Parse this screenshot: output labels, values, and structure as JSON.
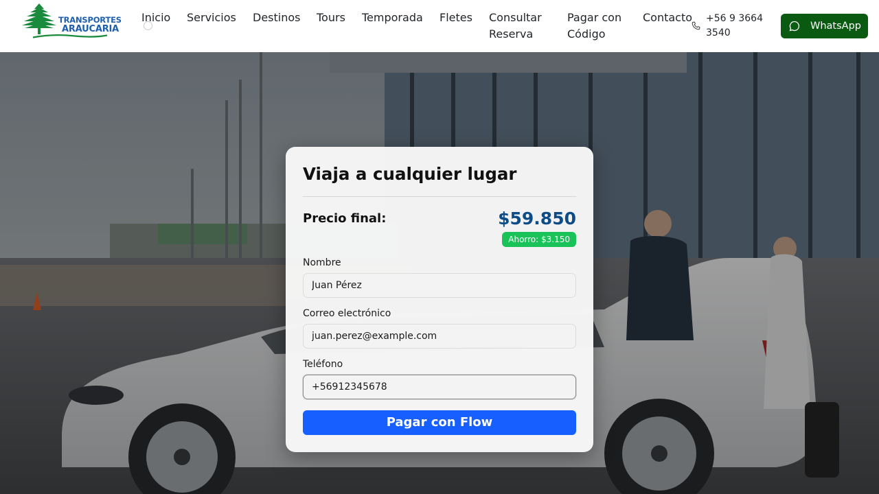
{
  "header": {
    "logo": {
      "line1": "TRANSPORTES",
      "line2": "ARAUCARIA",
      "icon": "araucaria-tree-icon"
    },
    "nav": [
      {
        "label": "Inicio"
      },
      {
        "label": "Servicios"
      },
      {
        "label": "Destinos"
      },
      {
        "label": "Tours"
      },
      {
        "label": "Temporada"
      },
      {
        "label": "Fletes"
      },
      {
        "label": "Consultar Reserva"
      },
      {
        "label": "Pagar con Código"
      },
      {
        "label": "Contacto"
      }
    ],
    "phone": {
      "icon": "phone-icon",
      "number": "+56 9 3664 3540"
    },
    "whatsapp": {
      "icon": "whatsapp-icon",
      "label": "WhatsApp"
    }
  },
  "card": {
    "title": "Viaja a cualquier lugar",
    "price_label": "Precio final:",
    "price_value": "$59.850",
    "savings": "Ahorro: $3.150",
    "fields": [
      {
        "label": "Nombre",
        "value": "Juan Pérez"
      },
      {
        "label": "Correo electrónico",
        "value": "juan.perez@example.com"
      },
      {
        "label": "Teléfono",
        "value": "+56912345678"
      }
    ],
    "submit_label": "Pagar con Flow"
  },
  "colors": {
    "brand_blue": "#1f5fae",
    "brand_green": "#1a8a3c",
    "price_blue": "#0d4c86",
    "savings_green": "#19c35a",
    "whatsapp_green": "#0a5a12",
    "pay_button_blue": "#1760ff"
  }
}
